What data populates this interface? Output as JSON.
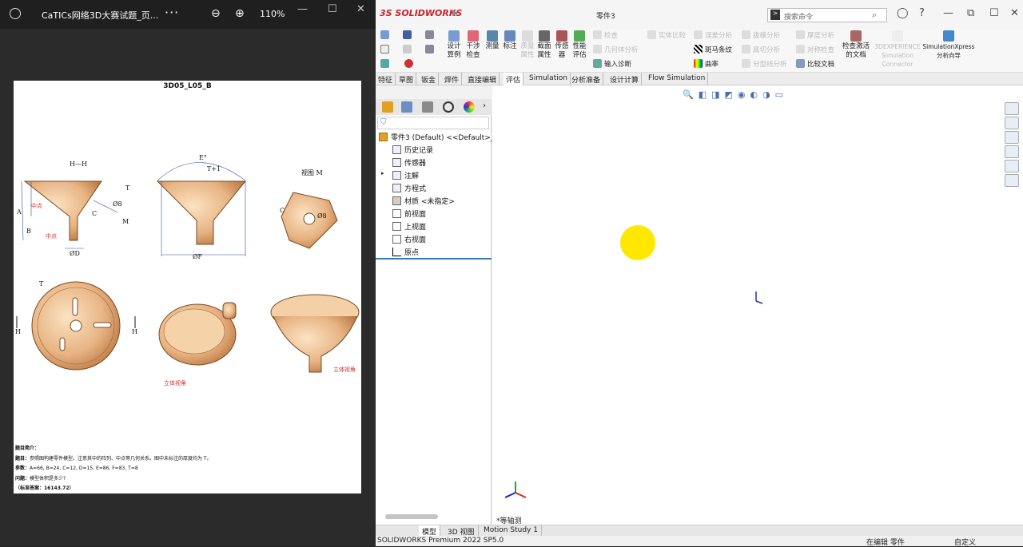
{
  "viewer": {
    "title": "CaTICs网络3D大赛试题_页...",
    "more": "···",
    "zoom_out": "⊖",
    "zoom_in": "⊕",
    "zoom": "110%",
    "win": {
      "min": "—",
      "max": "☐",
      "close": "✕"
    }
  },
  "drawing": {
    "title": "3D05_L05_B",
    "labels": {
      "hh": "H—H",
      "e": "E°",
      "t1": "T+1",
      "t": "T",
      "a": "A",
      "b": "B",
      "c": "C",
      "phiD": "ØD",
      "phiF": "ØF",
      "phi8": "Ø8",
      "phi8b": "Ø8",
      "m": "M",
      "c2": "C",
      "viewM": "视图 M",
      "mid1": "中点",
      "mid2": "中点",
      "t2": "T",
      "h1": "H",
      "h2": "H"
    },
    "iso1": "立体视角",
    "iso2": "立体视角",
    "desc": {
      "h": "题目简介：",
      "l1k": "题目：",
      "l1": "参照图构建零件模型。注意其中的阵列、中点等几何关系。图中未标注的厚度均为 T。",
      "l2k": "参数：",
      "l2": "A=66, B=24, C=12, D=15, E=86, F=83, T=8",
      "l3k": "问题：",
      "l3": "模型体积是多少?",
      "l4": "（标准答案：16143.72）"
    }
  },
  "sw": {
    "logo": "3S SOLIDWORKS",
    "file": "零件3",
    "search": "搜索命令",
    "ribbon": {
      "b1": "设计\n算例",
      "b2": "干涉\n检查",
      "b3": "测量",
      "b4": "标注",
      "b5": "质量\n属性",
      "b6": "截面\n属性",
      "b7": "传感\n器",
      "b8": "性能\n评估",
      "s1": "检查",
      "s2": "几何体分析",
      "s3": "输入诊断",
      "s4": "实体比较",
      "s5": "误差分析",
      "s6": "斑马条纹",
      "s7": "曲率",
      "s8": "拔模分析",
      "s9": "底切分析",
      "s10": "分型线分析",
      "s11": "厚度分析",
      "s12": "对称检查",
      "s13": "比较文档",
      "b9": "检查激活\n的文档",
      "b10": "3DEXPERIENCE\nSimulation\nConnector",
      "b11": "SimulationXpress\n分析向导"
    },
    "tabs": [
      "特征",
      "草图",
      "钣金",
      "焊件",
      "直接编辑",
      "评估",
      "Simulation",
      "分析准备",
      "设计计算",
      "Flow Simulation"
    ],
    "active_tab": "评估",
    "tree": {
      "root": "零件3 (Default) <<Default>_F",
      "items": [
        "历史记录",
        "传感器",
        "注解",
        "方程式",
        "材质 <未指定>",
        "前视面",
        "上视面",
        "右视面",
        "原点"
      ]
    },
    "view": "*等轴测",
    "btabs": [
      "模型",
      "3D 视图",
      "Motion Study 1"
    ],
    "status": {
      "left": "SOLIDWORKS Premium 2022 SP5.0",
      "mid": "在编辑 零件",
      "right": "自定义"
    }
  }
}
